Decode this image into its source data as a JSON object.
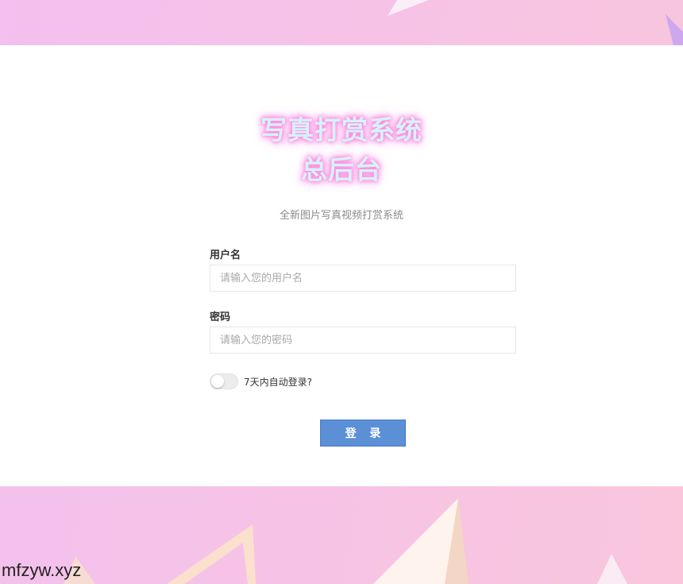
{
  "login": {
    "title_line1": "写真打赏系统",
    "title_line2": "总后台",
    "subtitle": "全新图片写真视频打赏系统",
    "username": {
      "label": "用户名",
      "placeholder": "请输入您的用户名",
      "value": ""
    },
    "password": {
      "label": "密码",
      "placeholder": "请输入您的密码",
      "value": ""
    },
    "remember": {
      "label": "7天内自动登录?",
      "checked": false
    },
    "submit_label": "登 录"
  },
  "watermark": "mfzyw.xyz",
  "colors": {
    "background_pink": "#f6c3e6",
    "button_blue": "#5b8fd6",
    "title_fill": "#d5f3fb",
    "title_glow": "#ff8fe0"
  }
}
